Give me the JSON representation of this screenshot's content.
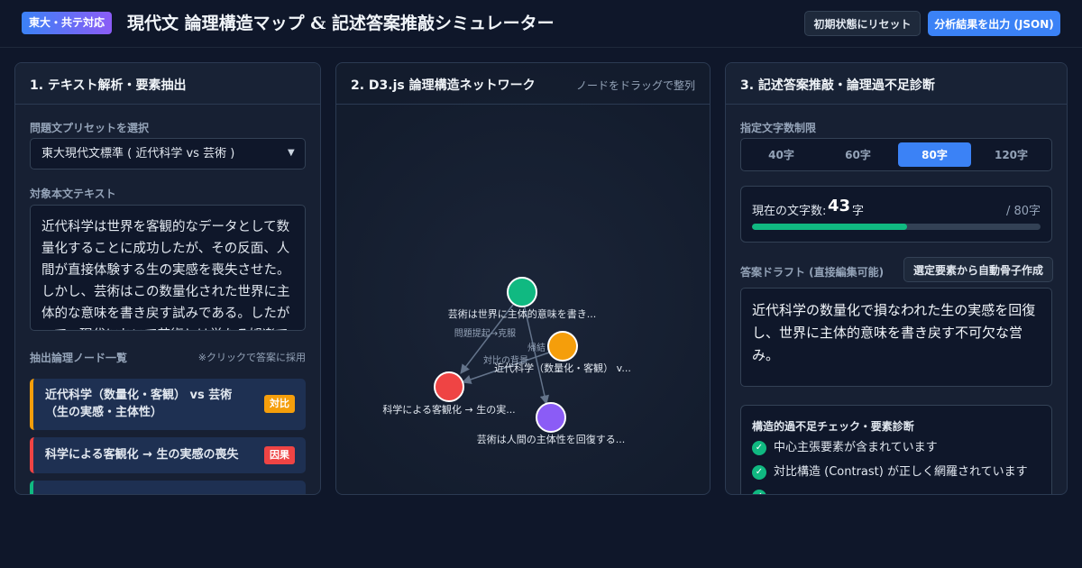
{
  "header": {
    "badge": "東大・共テ対応",
    "title": "現代文 論理構造マップ & 記述答案推敲シミュレーター",
    "reset_label": "初期状態にリセット",
    "export_label": "分析結果を出力 (JSON)"
  },
  "panel1": {
    "title": "1. テキスト解析・要素抽出",
    "preset_label": "問題文プリセットを選択",
    "preset_value": "東大現代文標準 ( 近代科学 vs 芸術 )",
    "text_label": "対象本文テキスト",
    "text_value": "近代科学は世界を客観的なデータとして数量化することに成功したが、その反面、人間が直接体験する生の実感を喪失させた。しかし、芸術はこの数量化された世界に主体的な意味を書き戻す試みである。したがって、現代において芸術とは単なる娯楽ではなく、",
    "nodes_label": "抽出論理ノード一覧",
    "nodes_hint": "※クリックで答案に採用",
    "nodes": [
      {
        "label": "近代科学（数量化・客観） vs 芸術（生の実感・主体性）",
        "tag": "対比",
        "color": "#f59e0b"
      },
      {
        "label": "科学による客観化 → 生の実感の喪失",
        "tag": "因果",
        "color": "#ef4444"
      },
      {
        "label": "",
        "tag": "",
        "color": "#10b981"
      }
    ]
  },
  "panel2": {
    "title": "2. D3.js 論理構造ネットワーク",
    "hint": "ノードをドラッグで整列",
    "graph_nodes": [
      {
        "label": "芸術は世界に主体的意味を書き...",
        "color": "#10b981"
      },
      {
        "label": "近代科学（数量化・客観） v...",
        "color": "#f59e0b"
      },
      {
        "label": "科学による客観化 → 生の実...",
        "color": "#ef4444"
      },
      {
        "label": "芸術は人間の主体性を回復する...",
        "color": "#8b5cf6"
      }
    ],
    "graph_edges": [
      {
        "label": "問題提起→克服"
      },
      {
        "label": "帰結"
      },
      {
        "label": "対比の背景"
      }
    ]
  },
  "panel3": {
    "title": "3. 記述答案推敲・論理過不足診断",
    "limit_label": "指定文字数制限",
    "limits": [
      "40字",
      "60字",
      "80字",
      "120字"
    ],
    "active_limit": 2,
    "count_label": "現在の文字数:",
    "count_value": "43",
    "count_unit": "字",
    "count_max": "/ 80字",
    "progress_fraction": 0.5375,
    "draft_label": "答案ドラフト (直接編集可能)",
    "auto_label": "選定要素から自動骨子作成",
    "draft_value": "近代科学の数量化で損なわれた生の実感を回復し、世界に主体的意味を書き戻す不可欠な営み。",
    "diag_title": "構造的過不足チェック・要素診断",
    "checks": [
      "中心主張要素が含まれています",
      "対比構造 (Contrast) が正しく網羅されています"
    ]
  }
}
